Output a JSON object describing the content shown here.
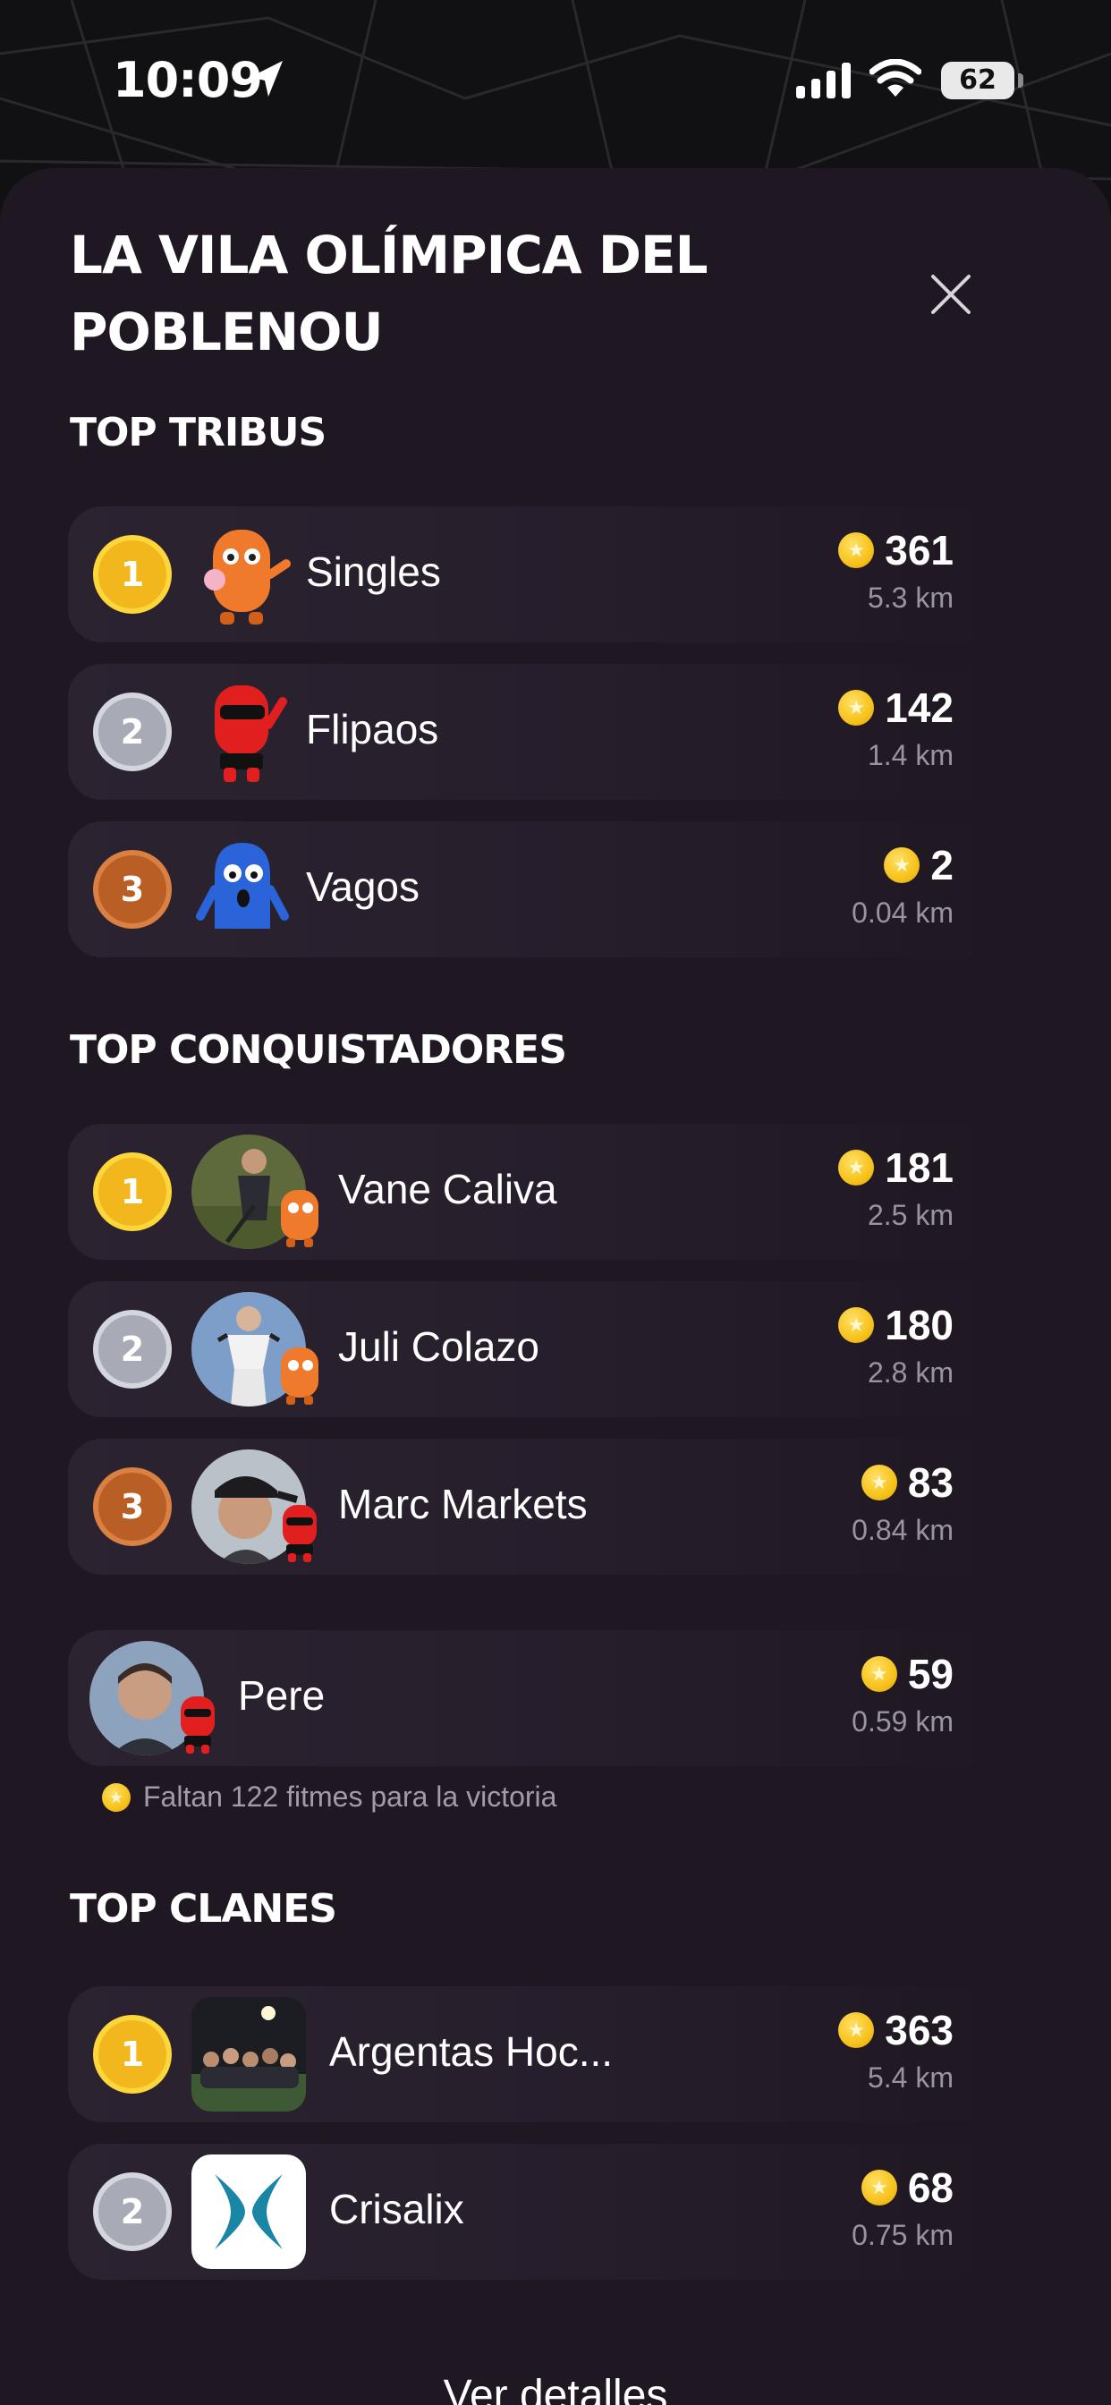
{
  "status_bar": {
    "time": "10:09",
    "battery": "62",
    "icons": [
      "location-arrow-icon",
      "signal-icon",
      "wifi-icon",
      "battery-icon"
    ]
  },
  "sheet": {
    "title": "La Vila Olímpica del Poblenou",
    "close_icon": "close-icon"
  },
  "top_tribus": {
    "title": "Top tribus",
    "items": [
      {
        "rank": "1",
        "name": "Singles",
        "score": "361",
        "distance": "5.3 km",
        "mascot_color": "#f07a2c"
      },
      {
        "rank": "2",
        "name": "Flipaos",
        "score": "142",
        "distance": "1.4 km",
        "mascot_color": "#e11f1f"
      },
      {
        "rank": "3",
        "name": "Vagos",
        "score": "2",
        "distance": "0.04 km",
        "mascot_color": "#2b63d9"
      }
    ]
  },
  "top_conquistadores": {
    "title": "Top conquistadores",
    "items": [
      {
        "rank": "1",
        "name": "Vane Caliva",
        "score": "181",
        "distance": "2.5 km"
      },
      {
        "rank": "2",
        "name": "Juli Colazo",
        "score": "180",
        "distance": "2.8 km"
      },
      {
        "rank": "3",
        "name": "Marc Markets",
        "score": "83",
        "distance": "0.84 km"
      }
    ],
    "me": {
      "name": "Pere",
      "score": "59",
      "distance": "0.59 km"
    },
    "hint": "Faltan 122 fitmes para la victoria"
  },
  "top_clanes": {
    "title": "Top clanes",
    "items": [
      {
        "rank": "1",
        "name": "Argentas Hoc...",
        "score": "363",
        "distance": "5.4 km"
      },
      {
        "rank": "2",
        "name": "Crisalix",
        "score": "68",
        "distance": "0.75 km"
      }
    ]
  },
  "footer": {
    "link_label": "Ver detalles"
  },
  "colors": {
    "sheet_bg": "#1f1822",
    "gold": "#f2b71c",
    "silver": "#a8aab6",
    "bronze": "#b95f26",
    "coin": "#f7c21b"
  }
}
